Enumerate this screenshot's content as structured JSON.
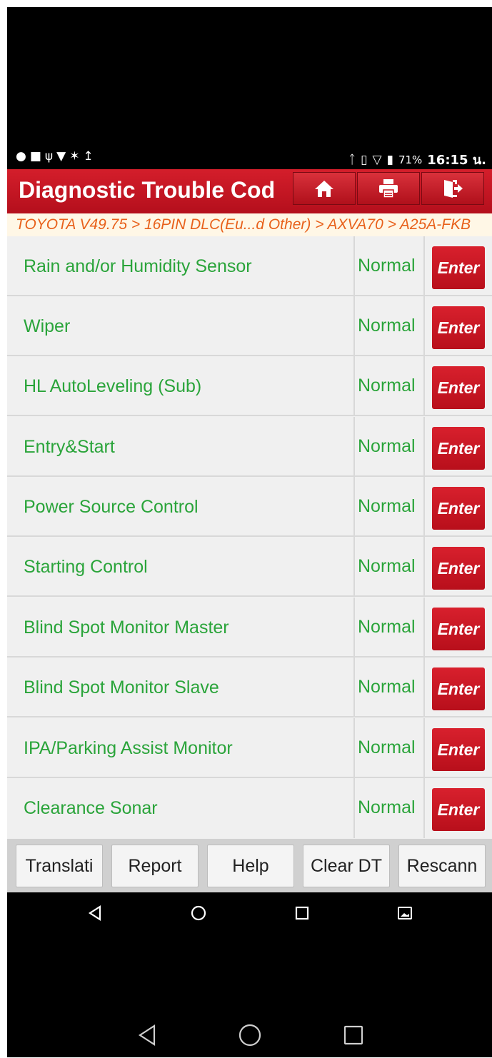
{
  "status_bar": {
    "left_icons": [
      "chat-bubble-icon",
      "image-icon",
      "stethoscope-icon",
      "wifi-question-icon",
      "bluetooth-scanner-icon",
      "upload-icon"
    ],
    "right_icons": [
      "bluetooth-icon",
      "vibrate-icon",
      "signal-icon",
      "battery-icon"
    ],
    "battery_percent": "71%",
    "time": "16:15 น."
  },
  "header": {
    "title": "Diagnostic Trouble Cod",
    "buttons": [
      "home-icon",
      "print-icon",
      "exit-icon"
    ],
    "accent_color": "#c4151f"
  },
  "breadcrumb": "TOYOTA V49.75 > 16PIN DLC(Eu...d Other) > AXVA70 > A25A-FKB",
  "systems": [
    {
      "name": "Rain and/or Humidity Sensor",
      "status": "Normal",
      "action": "Enter"
    },
    {
      "name": "Wiper",
      "status": "Normal",
      "action": "Enter"
    },
    {
      "name": "HL AutoLeveling (Sub)",
      "status": "Normal",
      "action": "Enter"
    },
    {
      "name": "Entry&Start",
      "status": "Normal",
      "action": "Enter"
    },
    {
      "name": "Power Source Control",
      "status": "Normal",
      "action": "Enter"
    },
    {
      "name": "Starting Control",
      "status": "Normal",
      "action": "Enter"
    },
    {
      "name": "Blind Spot Monitor Master",
      "status": "Normal",
      "action": "Enter"
    },
    {
      "name": "Blind Spot Monitor Slave",
      "status": "Normal",
      "action": "Enter"
    },
    {
      "name": "IPA/Parking Assist Monitor",
      "status": "Normal",
      "action": "Enter"
    },
    {
      "name": "Clearance Sonar",
      "status": "Normal",
      "action": "Enter"
    }
  ],
  "actions": [
    "Translati",
    "Report",
    "Help",
    "Clear DT",
    "Rescann"
  ],
  "colors": {
    "status_green": "#2aa43a",
    "enter_red": "#c8161f",
    "breadcrumb_orange": "#e8611b"
  }
}
